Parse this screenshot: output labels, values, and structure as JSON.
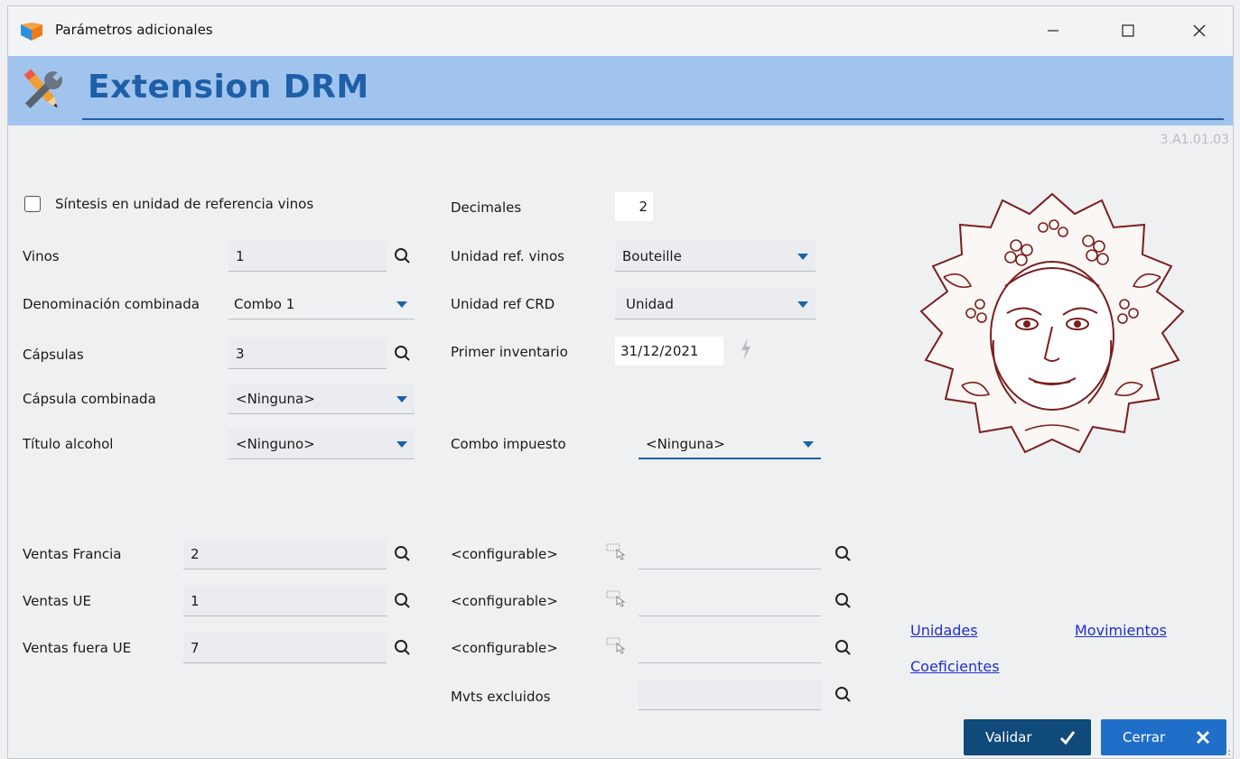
{
  "window": {
    "title": "Parámetros adicionales"
  },
  "header": {
    "title": "Extension DRM",
    "version": "3.A1.01.03"
  },
  "form": {
    "sintesis_label": "Síntesis en unidad de referencia vinos",
    "sintesis_checked": false,
    "vinos": {
      "label": "Vinos",
      "value": "1"
    },
    "denominacion": {
      "label": "Denominación combinada",
      "value": "Combo 1"
    },
    "capsulas": {
      "label": "Cápsulas",
      "value": "3"
    },
    "capsula_combinada": {
      "label": "Cápsula combinada",
      "value": "<Ninguna>"
    },
    "titulo_alcohol": {
      "label": "Título alcohol",
      "value": "<Ninguno>"
    },
    "decimales": {
      "label": "Decimales",
      "value": "2"
    },
    "unidad_ref_vinos": {
      "label": "Unidad ref. vinos",
      "value": "Bouteille"
    },
    "unidad_ref_crd": {
      "label": "Unidad ref CRD",
      "value": "Unidad"
    },
    "primer_inventario": {
      "label": "Primer inventario",
      "value": "31/12/2021"
    },
    "combo_impuesto": {
      "label": "Combo impuesto",
      "value": "<Ninguna>"
    },
    "ventas_francia": {
      "label": "Ventas Francia",
      "value": "2"
    },
    "ventas_ue": {
      "label": "Ventas UE",
      "value": "1"
    },
    "ventas_fuera_ue": {
      "label": "Ventas fuera UE",
      "value": "7"
    },
    "configurable_1": {
      "label": "<configurable>",
      "value": ""
    },
    "configurable_2": {
      "label": "<configurable>",
      "value": ""
    },
    "configurable_3": {
      "label": "<configurable>",
      "value": ""
    },
    "mvts_excluidos": {
      "label": "Mvts excluidos",
      "value": ""
    }
  },
  "links": {
    "unidades": "Unidades",
    "movimientos": "Movimientos",
    "coeficientes": "Coeficientes"
  },
  "buttons": {
    "validar": "Validar",
    "cerrar": "Cerrar"
  },
  "icons": {
    "app": "app-logo-icon",
    "header": "tools-icon",
    "search": "search-icon",
    "dropdown": "chevron-down-icon",
    "hand": "hand-pointer-icon",
    "bolt": "lightning-icon",
    "check": "check-icon",
    "close": "close-icon"
  },
  "colors": {
    "header_bg": "#a1c4ef",
    "header_title": "#1f5fa8",
    "validar_bg": "#0f4a7a",
    "cerrar_bg": "#1f6fc9",
    "link": "#1e2fd0",
    "emblem": "#7a1e1e"
  }
}
